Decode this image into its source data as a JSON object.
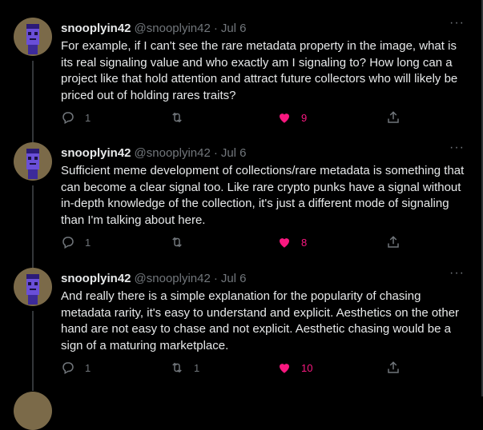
{
  "tweets": [
    {
      "name": "snooplyin42",
      "handle": "@snooplyin42",
      "date": "Jul 6",
      "text": "For example, if I can't see the rare metadata property in the image, what is its real signaling value and who exactly am I signaling to? How long can a project like that hold attention and attract future collectors who will likely be priced out of holding rares traits?",
      "replies": "1",
      "retweets": "",
      "likes": "9"
    },
    {
      "name": "snooplyin42",
      "handle": "@snooplyin42",
      "date": "Jul 6",
      "text": "Sufficient meme development of collections/rare metadata is something that can become a clear signal too. Like rare crypto punks have a signal without in-depth knowledge of the collection, it's just a different mode of signaling than I'm talking about here.",
      "replies": "1",
      "retweets": "",
      "likes": "8"
    },
    {
      "name": "snooplyin42",
      "handle": "@snooplyin42",
      "date": "Jul 6",
      "text": "And really there is a simple explanation for the popularity of chasing metadata rarity, it's easy to understand and explicit. Aesthetics on the other hand are not easy to chase and not explicit. Aesthetic chasing would be a sign of a maturing marketplace.",
      "replies": "1",
      "retweets": "1",
      "likes": "10"
    }
  ],
  "ui": {
    "separator": "·",
    "more": "···"
  },
  "icons": {
    "reply": "reply-icon",
    "retweet": "retweet-icon",
    "like": "heart-icon",
    "share": "share-icon",
    "more": "more-icon"
  },
  "colors": {
    "like": "#f91880",
    "muted": "#71767b",
    "text": "#e7e9ea",
    "background": "#000000"
  }
}
